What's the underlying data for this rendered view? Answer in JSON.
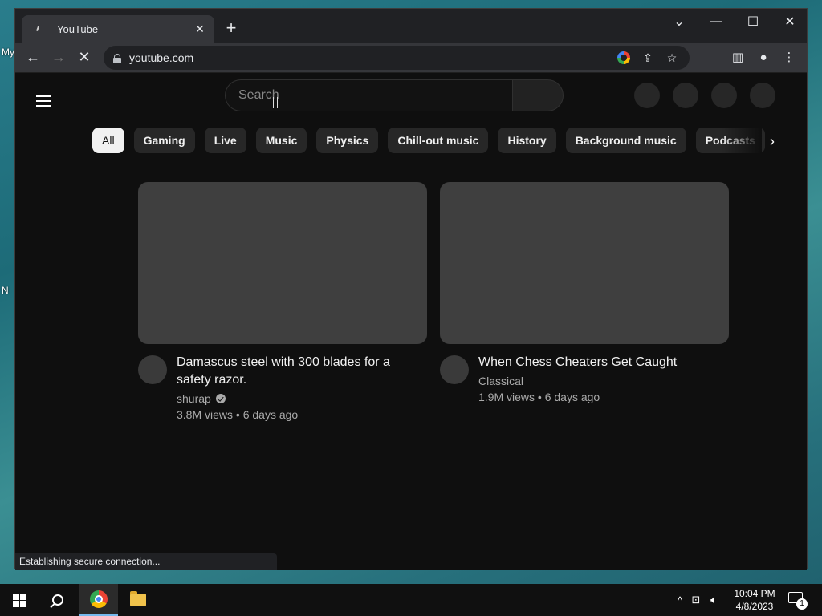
{
  "desktop": {
    "frag1": "My",
    "frag2": "N"
  },
  "browser": {
    "tab_title": "YouTube",
    "url": "youtube.com",
    "status_text": "Establishing secure connection..."
  },
  "youtube": {
    "search_placeholder": "Search",
    "chips": [
      {
        "label": "All",
        "active": true
      },
      {
        "label": "Gaming"
      },
      {
        "label": "Live"
      },
      {
        "label": "Music"
      },
      {
        "label": "Physics"
      },
      {
        "label": "Chill-out music"
      },
      {
        "label": "History"
      },
      {
        "label": "Background music"
      },
      {
        "label": "Podcasts"
      }
    ],
    "videos": [
      {
        "title": "Damascus steel with 300 blades for a safety razor.",
        "channel": "shurap",
        "verified": true,
        "stats": "3.8M views • 6 days ago"
      },
      {
        "title": "When Chess Cheaters Get Caught",
        "channel": "Classical",
        "verified": false,
        "stats": "1.9M views • 6 days ago"
      }
    ]
  },
  "taskbar": {
    "time": "10:04 PM",
    "date": "4/8/2023",
    "notification_count": "1"
  }
}
